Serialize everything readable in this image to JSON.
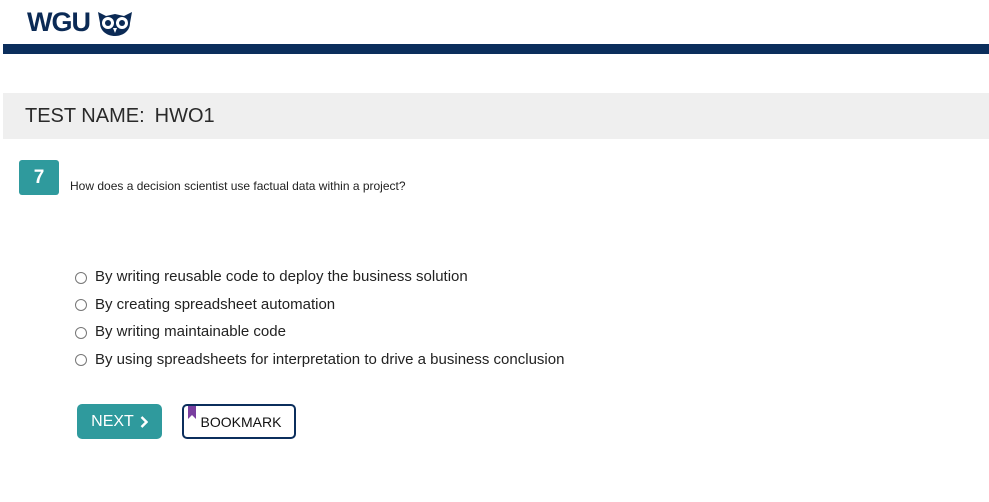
{
  "header": {
    "logo_text": "WGU",
    "logo_icon": "owl-icon",
    "brand_color": "#0b2e5c"
  },
  "test": {
    "label": "TEST NAME:",
    "name": "HWO1"
  },
  "question": {
    "number": "7",
    "text": "How does a decision scientist use factual data within a project?",
    "options": [
      "By writing reusable code to deploy the business solution",
      "By creating spreadsheet automation",
      "By writing maintainable code",
      "By using spreadsheets for interpretation to drive a business conclusion"
    ]
  },
  "actions": {
    "next_label": "NEXT",
    "next_icon": "chevron-right-icon",
    "bookmark_label": "BOOKMARK",
    "bookmark_icon": "bookmark-icon",
    "accent_color": "#2f9a9d",
    "bookmark_color": "#7a3fa0"
  }
}
